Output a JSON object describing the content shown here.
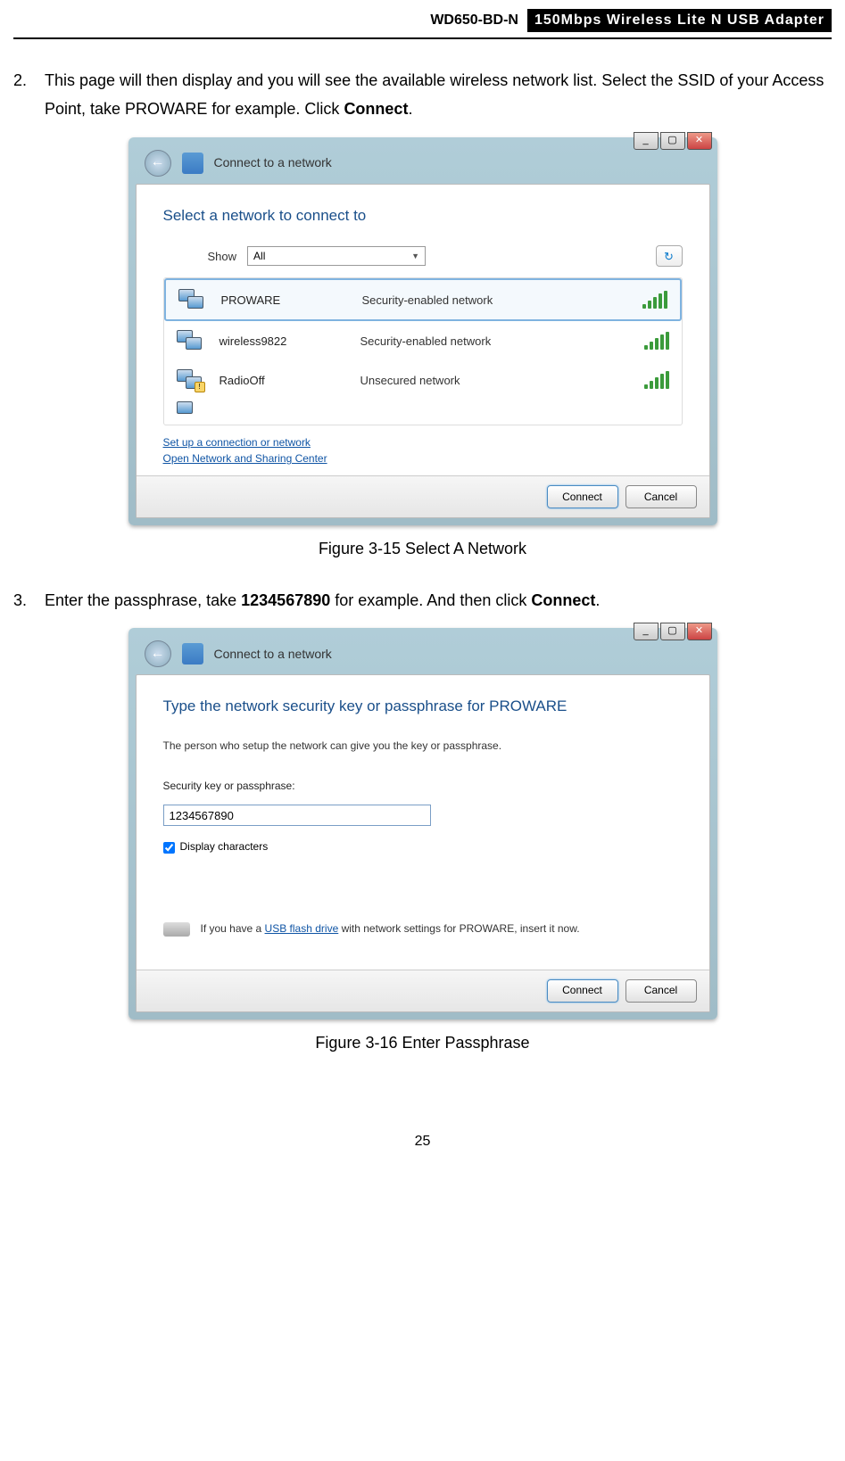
{
  "header": {
    "model": "WD650-BD-N",
    "title": "150Mbps Wireless Lite N USB Adapter"
  },
  "step2": {
    "num": "2.",
    "text_a": "This page will then display and you will see the available wireless network list. Select the SSID of your Access Point, take PROWARE for example. Click ",
    "bold": "Connect",
    "text_b": "."
  },
  "dialog1": {
    "nav_title": "Connect to a network",
    "heading": "Select a network to connect to",
    "show_label": "Show",
    "show_value": "All",
    "networks": [
      {
        "name": "PROWARE",
        "security": "Security-enabled network",
        "locked": false,
        "selected": true
      },
      {
        "name": "wireless9822",
        "security": "Security-enabled network",
        "locked": false,
        "selected": false
      },
      {
        "name": "RadioOff",
        "security": "Unsecured network",
        "locked": true,
        "selected": false
      }
    ],
    "link1": "Set up a connection or network",
    "link2": "Open Network and Sharing Center",
    "connect": "Connect",
    "cancel": "Cancel"
  },
  "caption1": "Figure 3-15 Select A Network",
  "step3": {
    "num": "3.",
    "text_a": "Enter the passphrase, take ",
    "bold1": "1234567890",
    "text_b": " for example. And then click ",
    "bold2": "Connect",
    "text_c": "."
  },
  "dialog2": {
    "nav_title": "Connect to a network",
    "heading": "Type the network security key or passphrase for PROWARE",
    "subtext": "The person who setup the network can give you the key or passphrase.",
    "field_label": "Security key or passphrase:",
    "input_value": "1234567890",
    "display_chars": "Display characters",
    "usb_a": "If you have a ",
    "usb_link": "USB flash drive",
    "usb_b": " with network settings for PROWARE, insert it now.",
    "connect": "Connect",
    "cancel": "Cancel"
  },
  "caption2": "Figure 3-16 Enter Passphrase",
  "page_num": "25"
}
